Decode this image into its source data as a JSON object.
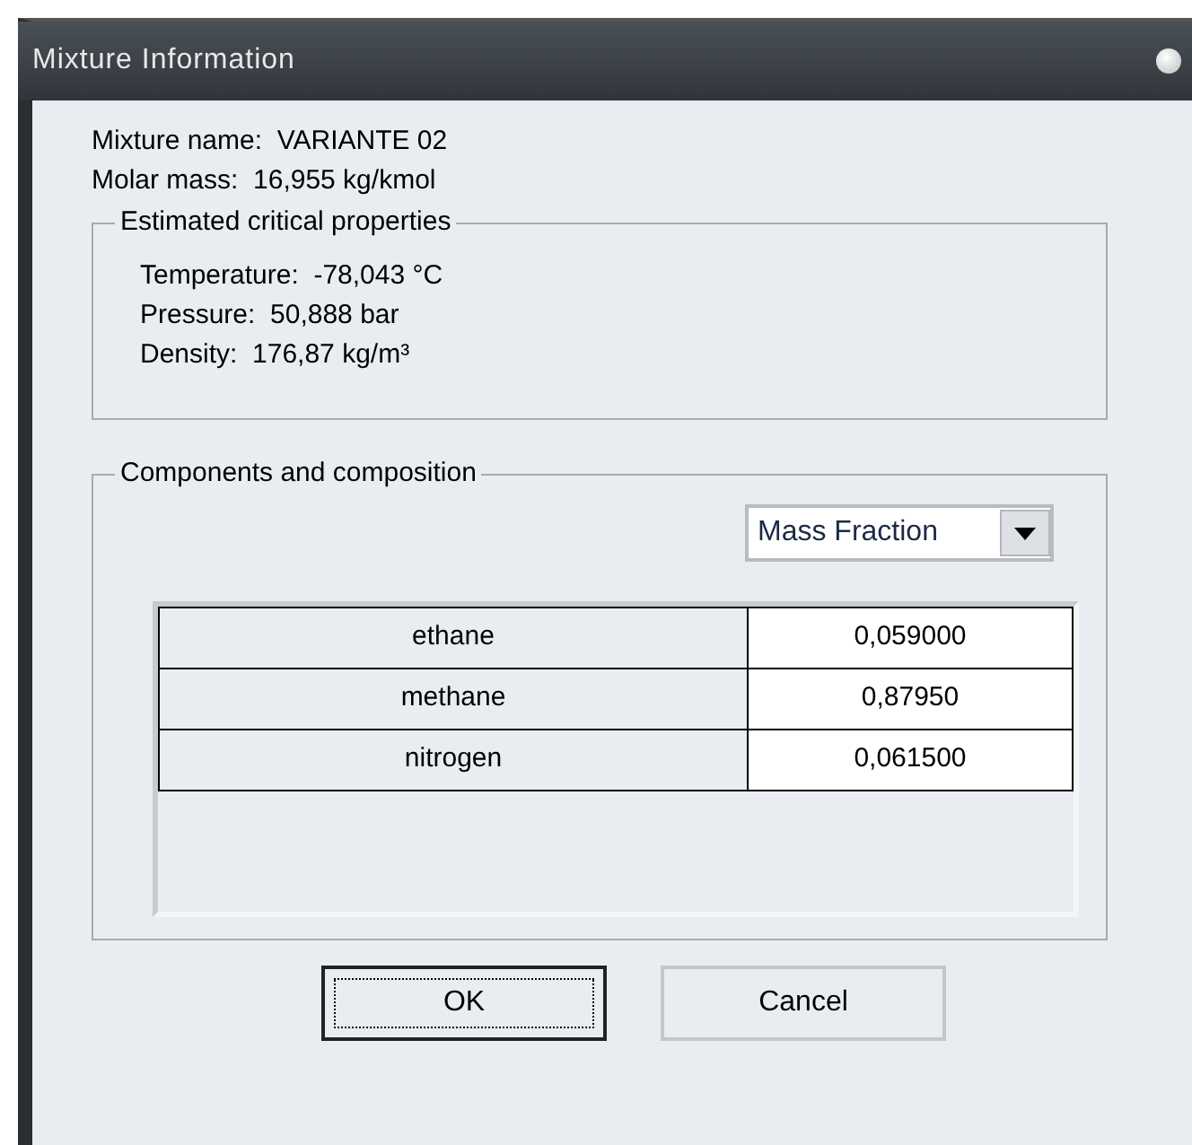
{
  "window": {
    "title": "Mixture Information"
  },
  "info": [
    {
      "label": "Mixture name:",
      "value": "VARIANTE 02"
    },
    {
      "label": "Molar mass:",
      "value": "16,955 kg/kmol"
    }
  ],
  "critical_properties": {
    "title": "Estimated critical properties",
    "items": [
      {
        "label": "Temperature:",
        "value": "-78,043 °C"
      },
      {
        "label": "Pressure:",
        "value": "50,888 bar"
      },
      {
        "label": "Density:",
        "value": "176,87 kg/m³"
      }
    ]
  },
  "components": {
    "title": "Components and composition",
    "dropdown": {
      "value": "Mass Fraction"
    },
    "rows": [
      {
        "name": "ethane",
        "value": "0,059000"
      },
      {
        "name": "methane",
        "value": "0,87950"
      },
      {
        "name": "nitrogen",
        "value": "0,061500"
      }
    ]
  },
  "buttons": [
    {
      "label": "OK",
      "default": true
    },
    {
      "label": "Cancel",
      "default": false
    }
  ]
}
